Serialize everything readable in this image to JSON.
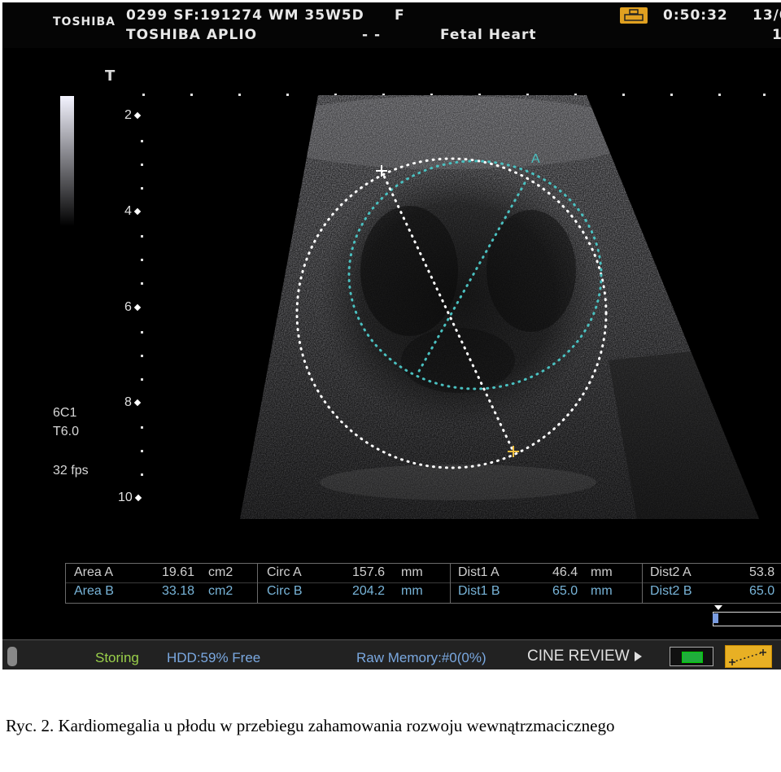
{
  "header": {
    "brand": "TOSHIBA",
    "line1": "0299 SF:191274 WM 35W5D",
    "line1_flag": "F",
    "line2": "TOSHIBA APLIO",
    "line2_dash": "- -",
    "preset": "Fetal Heart",
    "time": "0:50:32",
    "date": "13/0",
    "frame": "1"
  },
  "left_panel": {
    "marker": "T",
    "depths": [
      "2",
      "4",
      "6",
      "8",
      "10"
    ],
    "probe": "6C1",
    "freq": "T6.0",
    "fps": "32 fps"
  },
  "image": {
    "label_a": "A"
  },
  "measurements": {
    "row_a": [
      "Area  A",
      "19.61",
      "cm2",
      "Circ  A",
      "157.6",
      "mm",
      "Dist1  A",
      "46.4",
      "mm",
      "Dist2  A",
      "53.8"
    ],
    "row_b": [
      "Area  B",
      "33.18",
      "cm2",
      "Circ  B",
      "204.2",
      "mm",
      "Dist1  B",
      "65.0",
      "mm",
      "Dist2  B",
      "65.0"
    ]
  },
  "status": {
    "storing": "Storing",
    "hdd": "HDD:59% Free",
    "raw": "Raw Memory:#0(0%)",
    "cine": "CINE REVIEW"
  },
  "caption": "Ryc. 2. Kardiomegalia u płodu w przebiegu zahamowania rozwoju wewnątrzmacicznego",
  "colors": {
    "accent_orange": "#e8b024",
    "measure_b": "#78b4d8",
    "dotted_inner": "#4ac0c0"
  }
}
